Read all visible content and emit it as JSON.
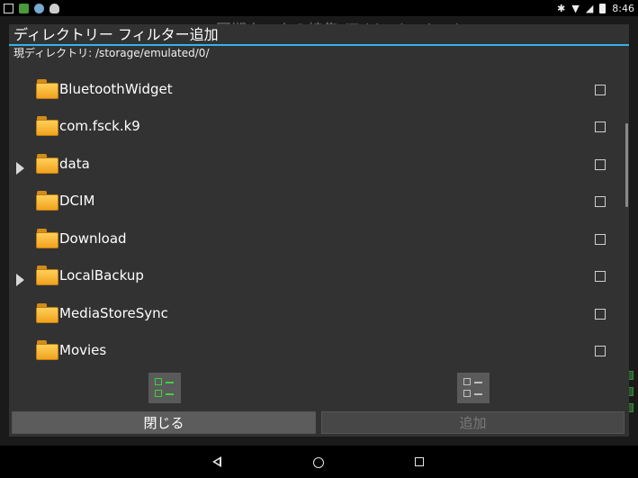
{
  "status_bar": {
    "time": "8:46",
    "icons": [
      "square-notification-icon",
      "green-app-icon",
      "blue-app-icon",
      "robot-icon",
      "bluetooth-icon",
      "wifi-icon",
      "signal-icon",
      "battery-icon"
    ],
    "bluetooth_glyph": "✱",
    "wifi_glyph": "▼",
    "signal_glyph": "◢"
  },
  "background_app": {
    "title": "同期タスクの編集 (Tablet backup)"
  },
  "dialog": {
    "title": "ディレクトリー フィルター追加",
    "current_dir_label": "現ディレクトリ: /storage/emulated/0/",
    "accent_color": "#33b5e5",
    "folders": [
      {
        "name": "BluetoothWidget",
        "expandable": false,
        "checked": false
      },
      {
        "name": "com.fsck.k9",
        "expandable": false,
        "checked": false
      },
      {
        "name": "data",
        "expandable": true,
        "checked": false
      },
      {
        "name": "DCIM",
        "expandable": false,
        "checked": false
      },
      {
        "name": "Download",
        "expandable": false,
        "checked": false
      },
      {
        "name": "LocalBackup",
        "expandable": true,
        "checked": false
      },
      {
        "name": "MediaStoreSync",
        "expandable": false,
        "checked": false
      },
      {
        "name": "Movies",
        "expandable": false,
        "checked": false
      }
    ],
    "select_all_icon": "select-all-icon",
    "unselect_all_icon": "unselect-all-icon",
    "close_button": "閉じる",
    "add_button": "追加"
  },
  "nav_bar": {
    "icons": [
      "back-icon",
      "home-icon",
      "recent-apps-icon"
    ]
  }
}
